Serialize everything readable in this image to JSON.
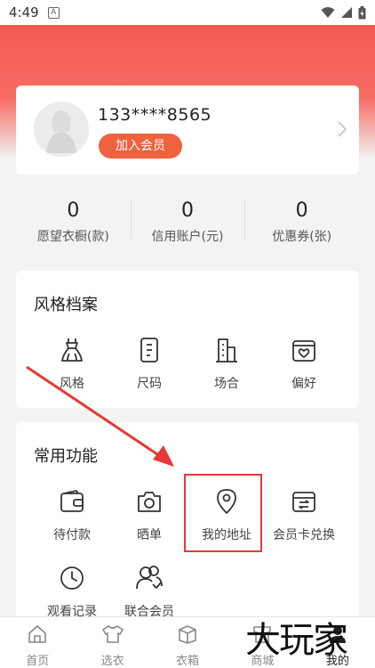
{
  "status_bar": {
    "time": "4:49",
    "notif_letter": "A"
  },
  "profile": {
    "phone": "133****8565",
    "join_label": "加入会员"
  },
  "stats": [
    {
      "value": "0",
      "label": "愿望衣橱(款)"
    },
    {
      "value": "0",
      "label": "信用账户(元)"
    },
    {
      "value": "0",
      "label": "优惠券(张)"
    }
  ],
  "style_section": {
    "title": "风格档案",
    "items": [
      {
        "label": "风格",
        "icon": "dress-icon"
      },
      {
        "label": "尺码",
        "icon": "size-card-icon"
      },
      {
        "label": "场合",
        "icon": "building-icon"
      },
      {
        "label": "偏好",
        "icon": "heart-box-icon"
      }
    ]
  },
  "func_section": {
    "title": "常用功能",
    "items": [
      {
        "label": "待付款",
        "icon": "wallet-icon"
      },
      {
        "label": "晒单",
        "icon": "camera-icon"
      },
      {
        "label": "我的地址",
        "icon": "location-pin-icon"
      },
      {
        "label": "会员卡兑换",
        "icon": "exchange-card-icon"
      },
      {
        "label": "观看记录",
        "icon": "clock-icon"
      },
      {
        "label": "联合会员",
        "icon": "users-icon"
      }
    ]
  },
  "tabs": [
    {
      "label": "首页",
      "icon": "home-icon"
    },
    {
      "label": "选衣",
      "icon": "shirt-icon"
    },
    {
      "label": "衣箱",
      "icon": "box-icon"
    },
    {
      "label": "商城",
      "icon": "shop-icon"
    },
    {
      "label": "我的",
      "icon": "user-icon"
    }
  ],
  "watermark": "大玩家",
  "colors": {
    "accent": "#f0613e",
    "header": "#f55a52",
    "annotation": "#e53935"
  }
}
